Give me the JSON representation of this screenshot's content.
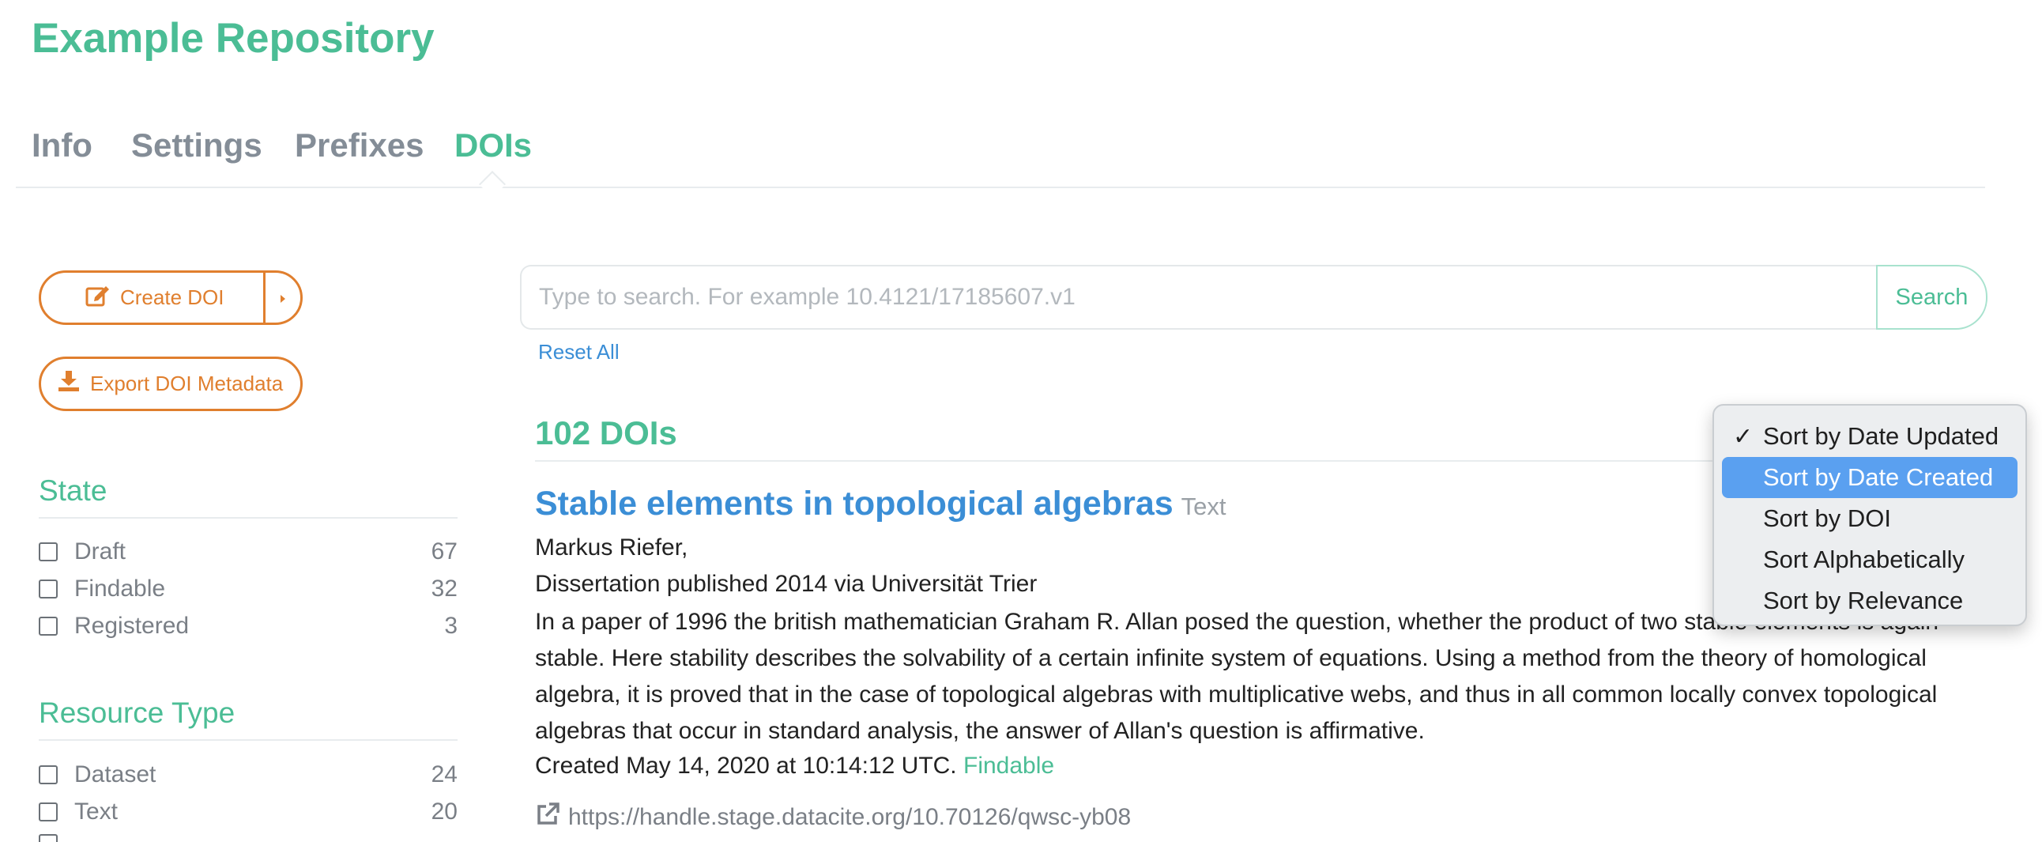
{
  "repository": {
    "title": "Example Repository"
  },
  "tabs": [
    {
      "label": "Info"
    },
    {
      "label": "Settings"
    },
    {
      "label": "Prefixes"
    },
    {
      "label": "DOIs",
      "active": true
    }
  ],
  "actions": {
    "create_label": "Create DOI",
    "export_label": "Export DOI Metadata"
  },
  "facets": {
    "state": {
      "title": "State",
      "items": [
        {
          "label": "Draft",
          "count": "67"
        },
        {
          "label": "Findable",
          "count": "32"
        },
        {
          "label": "Registered",
          "count": "3"
        }
      ]
    },
    "resource_type": {
      "title": "Resource Type",
      "items": [
        {
          "label": "Dataset",
          "count": "24"
        },
        {
          "label": "Text",
          "count": "20"
        }
      ]
    }
  },
  "search": {
    "placeholder": "Type to search. For example 10.4121/17185607.v1",
    "button_label": "Search",
    "reset_label": "Reset All"
  },
  "results": {
    "count_label": "102 DOIs",
    "items": [
      {
        "title": "Stable elements in topological algebras",
        "type": "Text",
        "creators": "Markus Riefer,",
        "publication": "Dissertation published 2014 via Universität Trier",
        "description": "In a paper of 1996 the british mathematician Graham R. Allan posed the question, whether the product of two stable elements is again stable. Here stability describes the solvability of a certain infinite system of equations. Using a method from the theory of homological algebra, it is proved that in the case of topological algebras with multiplicative webs, and thus in all common locally convex topological algebras that occur in standard analysis, the answer of Allan's question is affirmative.",
        "created": "Created May 14, 2020 at 10:14:12 UTC.",
        "status": "Findable",
        "url": "https://handle.stage.datacite.org/10.70126/qwsc-yb08"
      }
    ]
  },
  "sort_menu": {
    "selected": "Sort by Date Updated",
    "highlighted": "Sort by Date Created",
    "options": [
      "Sort by Date Updated",
      "Sort by Date Created",
      "Sort by DOI",
      "Sort Alphabetically",
      "Sort by Relevance"
    ]
  },
  "colors": {
    "brand_green": "#4bbd95",
    "link_blue": "#3b8ed6",
    "action_orange": "#e07f2e",
    "menu_highlight": "#5aa0f0"
  }
}
